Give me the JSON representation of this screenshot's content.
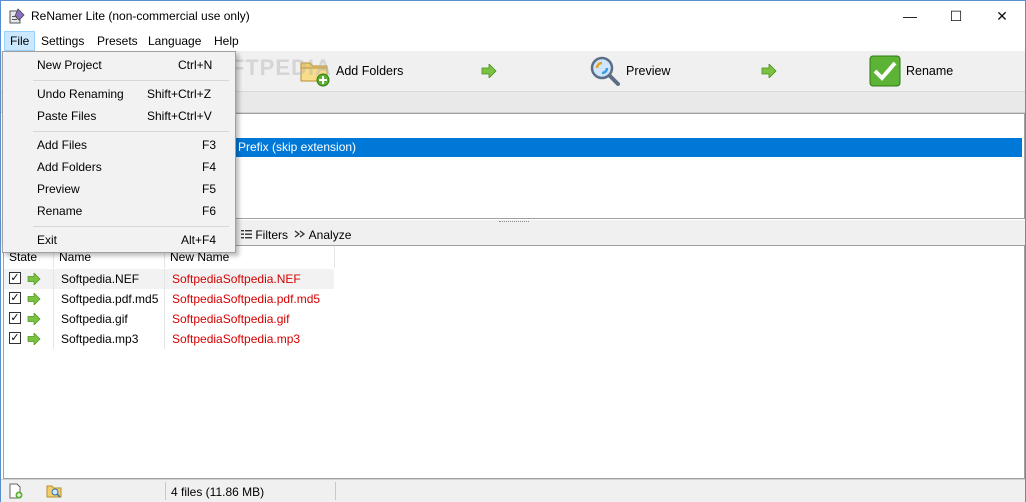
{
  "window": {
    "title": "ReNamer Lite (non-commercial use only)",
    "controls": {
      "minimize": "—",
      "maximize": "☐",
      "close": "✕"
    }
  },
  "menu": [
    "File",
    "Settings",
    "Presets",
    "Language",
    "Help"
  ],
  "toolbar": {
    "add_folders": "Add Folders",
    "preview": "Preview",
    "rename": "Rename"
  },
  "watermark": "SOFTPEDIA",
  "rules": {
    "selected_rule": "Prefix (skip extension)"
  },
  "files_toolbar": {
    "filters": "Filters",
    "analyze": "Analyze"
  },
  "filelist": {
    "columns": [
      "State",
      "Name",
      "New Name"
    ],
    "rows": [
      {
        "name": "Softpedia.NEF",
        "new_name": "SoftpediaSoftpedia.NEF",
        "checked": true
      },
      {
        "name": "Softpedia.pdf.md5",
        "new_name": "SoftpediaSoftpedia.pdf.md5",
        "checked": true
      },
      {
        "name": "Softpedia.gif",
        "new_name": "SoftpediaSoftpedia.gif",
        "checked": true
      },
      {
        "name": "Softpedia.mp3",
        "new_name": "SoftpediaSoftpedia.mp3",
        "checked": true
      }
    ]
  },
  "status": {
    "summary": "4 files (11.86 MB)"
  },
  "file_menu": {
    "items": [
      {
        "label": "New Project",
        "shortcut": "Ctrl+N"
      },
      {
        "label": "Undo Renaming",
        "shortcut": "Shift+Ctrl+Z"
      },
      {
        "label": "Paste Files",
        "shortcut": "Shift+Ctrl+V"
      },
      {
        "label": "Add Files",
        "shortcut": "F3"
      },
      {
        "label": "Add Folders",
        "shortcut": "F4"
      },
      {
        "label": "Preview",
        "shortcut": "F5"
      },
      {
        "label": "Rename",
        "shortcut": "F6"
      },
      {
        "label": "Exit",
        "shortcut": "Alt+F4"
      }
    ]
  },
  "colors": {
    "selection": "#0078d7",
    "new_name": "#d40000",
    "menu_highlight": "#cce8ff",
    "arrow_green": "#7cc242"
  }
}
